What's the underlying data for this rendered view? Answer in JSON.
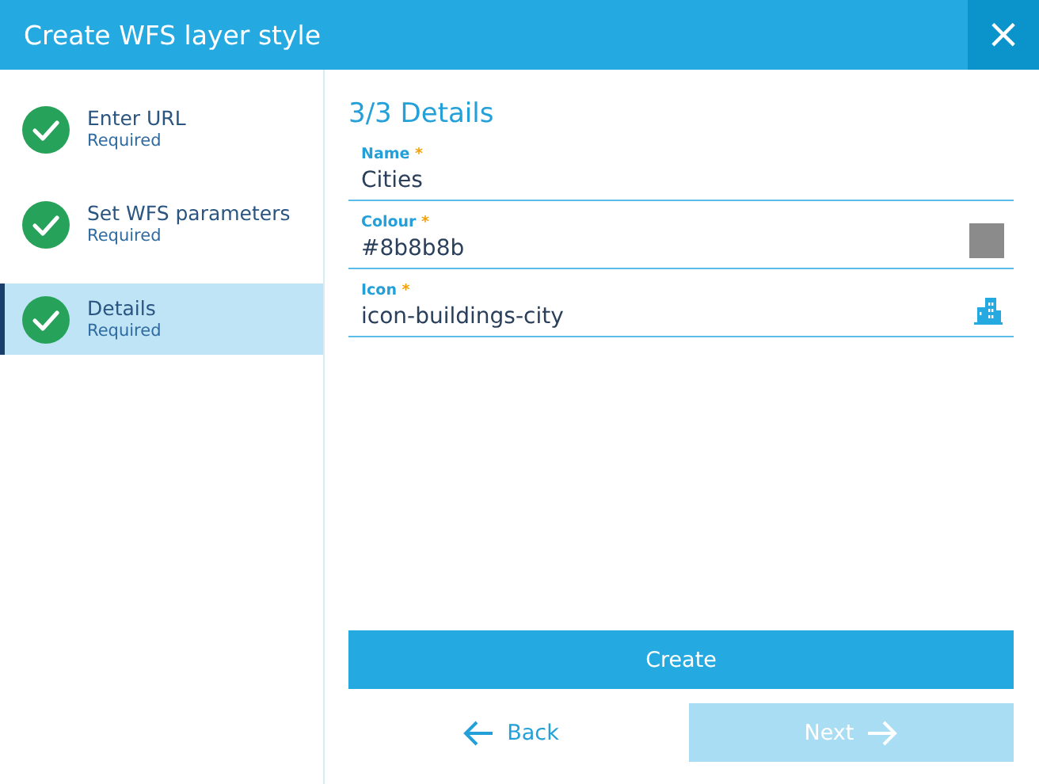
{
  "window": {
    "title": "Create WFS layer style",
    "close": "×"
  },
  "steps": [
    {
      "label": "Enter URL",
      "hint": "Required",
      "completed": true,
      "selected": false
    },
    {
      "label": "Set WFS parameters",
      "hint": "Required",
      "completed": true,
      "selected": false
    },
    {
      "label": "Details",
      "hint": "Required",
      "completed": true,
      "selected": true
    }
  ],
  "heading": "3/3 Details",
  "fields": [
    {
      "kind": "text",
      "label": "Name",
      "required_mark": "*",
      "value": "Cities"
    },
    {
      "kind": "color",
      "label": "Colour",
      "required_mark": "*",
      "value": "#8b8b8b"
    },
    {
      "kind": "icon",
      "label": "Icon",
      "required_mark": "*",
      "value": "icon-buildings-city"
    }
  ],
  "buttons": {
    "create": "Create",
    "back": "Back",
    "next": {
      "label": "Next",
      "disabled": true
    }
  }
}
